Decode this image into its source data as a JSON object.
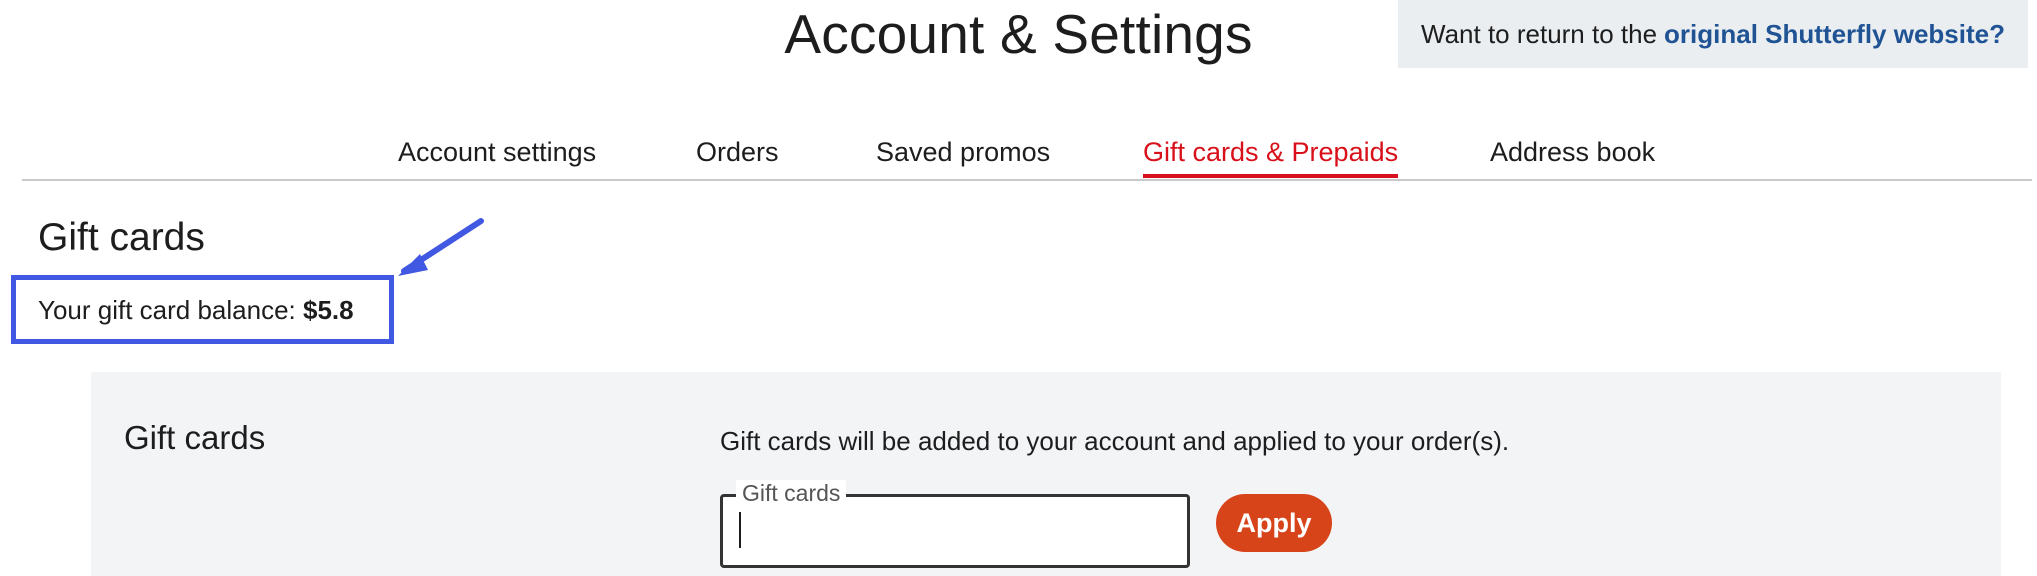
{
  "header": {
    "title": "Account & Settings",
    "legacy_prompt": "Want to return to the",
    "legacy_link": "original Shutterfly website?"
  },
  "tabs": [
    {
      "label": "Account settings",
      "active": false
    },
    {
      "label": "Orders",
      "active": false
    },
    {
      "label": "Saved promos",
      "active": false
    },
    {
      "label": "Gift cards & Prepaids",
      "active": true
    },
    {
      "label": "Address book",
      "active": false
    }
  ],
  "gift_cards": {
    "heading": "Gift cards",
    "balance_label": "Your gift card balance:",
    "balance_value": "$5.8"
  },
  "panel": {
    "title": "Gift cards",
    "note": "Gift cards will be added to your account and applied to your order(s).",
    "field_label": "Gift cards",
    "field_value": "",
    "apply_label": "Apply"
  },
  "colors": {
    "accent_red": "#d8101a",
    "apply_button": "#d8441a",
    "link_blue": "#1f5394",
    "annotation_blue": "#4158e3",
    "panel_bg": "#f3f4f6"
  }
}
